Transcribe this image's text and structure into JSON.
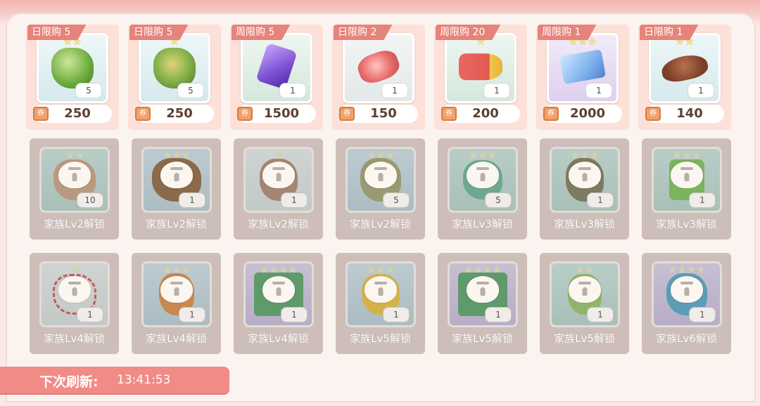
{
  "shop": {
    "row1": [
      {
        "limit": "日限购 5",
        "stars": "★★",
        "qty": "5",
        "price": "250",
        "icon": "green-potion-icon",
        "bg": ""
      },
      {
        "limit": "日限购 5",
        "stars": "★",
        "qty": "5",
        "price": "250",
        "icon": "green-bottle-icon",
        "bg": ""
      },
      {
        "limit": "周限购 5",
        "stars": "",
        "qty": "1",
        "price": "1500",
        "icon": "purple-crystal-icon",
        "bg": "green"
      },
      {
        "limit": "日限购 2",
        "stars": "",
        "qty": "1",
        "price": "150",
        "icon": "meat-icon",
        "bg": "grey"
      },
      {
        "limit": "周限购 20",
        "stars": "★",
        "qty": "1",
        "price": "200",
        "icon": "megaphone-icon",
        "bg": "green"
      },
      {
        "limit": "周限购 1",
        "stars": "★★★",
        "qty": "1",
        "price": "2000",
        "icon": "ticket-plus10-icon",
        "bg": "purple"
      },
      {
        "limit": "日限购 1",
        "stars": "★★",
        "qty": "1",
        "price": "140",
        "icon": "brown-hat-icon",
        "bg": ""
      }
    ],
    "row2": [
      {
        "stars": "★★",
        "qty": "10",
        "label": "家族Lv2解锁",
        "bg": ""
      },
      {
        "stars": "★★★",
        "qty": "1",
        "label": "家族Lv2解锁",
        "bg": "blue"
      },
      {
        "stars": "★",
        "qty": "1",
        "label": "家族Lv2解锁",
        "bg": "grey"
      },
      {
        "stars": "★★★",
        "qty": "5",
        "label": "家族Lv2解锁",
        "bg": "blue"
      },
      {
        "stars": "★★★",
        "qty": "5",
        "label": "家族Lv3解锁",
        "bg": ""
      },
      {
        "stars": "★★★",
        "qty": "1",
        "label": "家族Lv3解锁",
        "bg": ""
      },
      {
        "stars": "★★★",
        "qty": "1",
        "label": "家族Lv3解锁",
        "bg": ""
      }
    ],
    "row3": [
      {
        "stars": "★",
        "qty": "1",
        "label": "家族Lv4解锁",
        "bg": "grey"
      },
      {
        "stars": "★★★",
        "qty": "1",
        "label": "家族Lv4解锁",
        "bg": "blue"
      },
      {
        "stars": "★★★★",
        "qty": "1",
        "label": "家族Lv4解锁",
        "bg": "purple"
      },
      {
        "stars": "★★★",
        "qty": "1",
        "label": "家族Lv5解锁",
        "bg": "blue"
      },
      {
        "stars": "★★★★",
        "qty": "1",
        "label": "家族Lv5解锁",
        "bg": "purple"
      },
      {
        "stars": "★★",
        "qty": "1",
        "label": "家族Lv5解锁",
        "bg": ""
      },
      {
        "stars": "★★★★",
        "qty": "1",
        "label": "家族Lv6解锁",
        "bg": "purple"
      }
    ]
  },
  "refresh": {
    "label": "下次刷新:",
    "time": "13:41:53"
  },
  "colors": {
    "accent": "#f08b86",
    "tag": "#e6837a",
    "price_text": "#5d4030"
  }
}
